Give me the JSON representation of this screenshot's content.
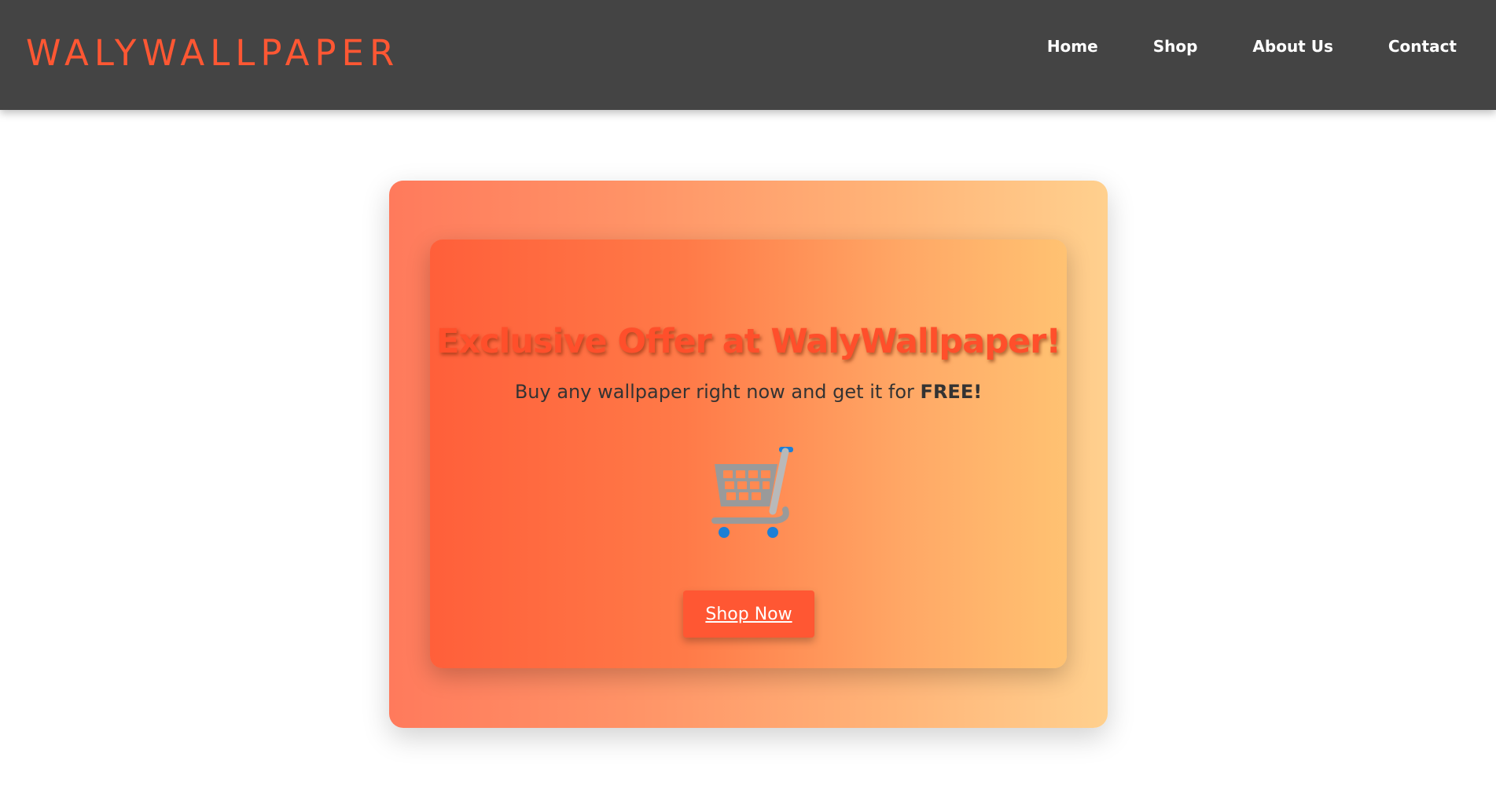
{
  "header": {
    "logo": "WALYWALLPAPER",
    "nav": [
      {
        "label": "Home"
      },
      {
        "label": "Shop"
      },
      {
        "label": "About Us"
      },
      {
        "label": "Contact"
      }
    ]
  },
  "promo": {
    "headline": "Exclusive Offer at WalyWallpaper!",
    "subtext_prefix": "Buy any wallpaper right now and get it for ",
    "subtext_emphasis": "FREE!",
    "icon": "shopping-cart-icon",
    "button_label": "Shop Now"
  },
  "colors": {
    "accent": "#ff5733",
    "header_bg": "#444444",
    "text_dark": "#333333"
  }
}
